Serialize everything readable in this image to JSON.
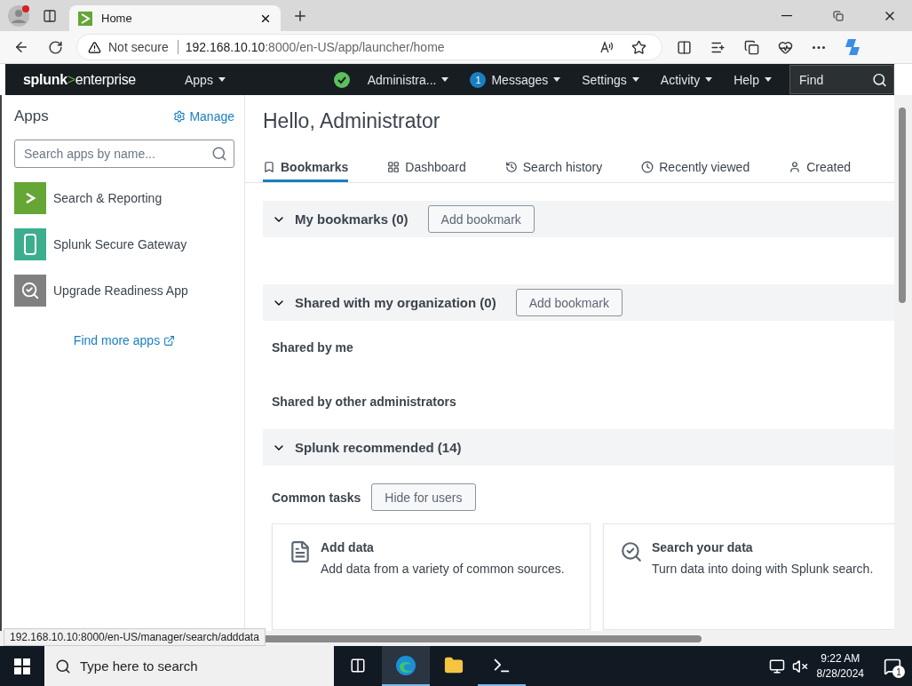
{
  "browser": {
    "tab": {
      "title": "Home"
    },
    "address": {
      "security": "Not secure",
      "host": "192.168.10.10",
      "path": ":8000/en-US/app/launcher/home"
    }
  },
  "splunk_nav": {
    "logo": {
      "brand": "splunk",
      "mark": ">",
      "product": "enterprise"
    },
    "menus": [
      {
        "kind": "menu",
        "label": "Apps"
      },
      {
        "kind": "status",
        "label": "Administra..."
      },
      {
        "kind": "badge",
        "label": "Messages",
        "badge": "1"
      },
      {
        "kind": "menu",
        "label": "Settings"
      },
      {
        "kind": "menu",
        "label": "Activity"
      },
      {
        "kind": "menu",
        "label": "Help"
      }
    ],
    "find": {
      "placeholder": "Find"
    }
  },
  "sidebar": {
    "title": "Apps",
    "manage": "Manage",
    "search": {
      "placeholder": "Search apps by name..."
    },
    "apps": [
      {
        "kind": "search",
        "name": "Search & Reporting"
      },
      {
        "kind": "gateway",
        "name": "Splunk Secure Gateway"
      },
      {
        "kind": "readiness",
        "name": "Upgrade Readiness App"
      }
    ],
    "find_more": "Find more apps"
  },
  "main": {
    "greeting": "Hello, Administrator",
    "tabs": [
      {
        "kind": "bookmark",
        "label": "Bookmarks",
        "selected": true
      },
      {
        "kind": "dashboard",
        "label": "Dashboard",
        "selected": false
      },
      {
        "kind": "history",
        "label": "Search history",
        "selected": false
      },
      {
        "kind": "recent",
        "label": "Recently viewed",
        "selected": false
      },
      {
        "kind": "created",
        "label": "Created",
        "selected": false
      }
    ],
    "sections": [
      {
        "title": "My bookmarks (0)",
        "expanded": true,
        "button": "Add bookmark"
      },
      {
        "title": "Shared with my organization (0)",
        "expanded": true,
        "button": "Add bookmark",
        "subsections": [
          "Shared by me",
          "Shared by other administrators"
        ]
      },
      {
        "title": "Splunk recommended (14)",
        "expanded": true,
        "tasks": {
          "label": "Common tasks",
          "button": "Hide for users",
          "cards": [
            {
              "kind": "add",
              "title": "Add data",
              "description": "Add data from a variety of common sources."
            },
            {
              "kind": "search",
              "title": "Search your data",
              "description": "Turn data into doing with Splunk search."
            }
          ]
        }
      }
    ]
  },
  "status_url": "192.168.10.10:8000/en-US/manager/search/adddata",
  "taskbar": {
    "search": {
      "placeholder": "Type here to search"
    },
    "time": "9:22 AM",
    "date": "8/28/2024",
    "notifications": "1"
  }
}
